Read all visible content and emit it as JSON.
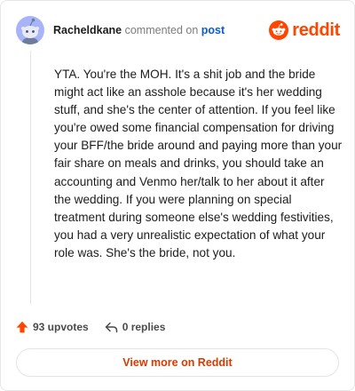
{
  "comment": {
    "username": "Racheldkane",
    "action_text": " commented on ",
    "post_link_text": "post",
    "body": "YTA. You're the MOH. It's a shit job and the bride might act like an asshole because it's her wedding stuff, and she's the center of attention. If you feel like you're owed some financial compensation for driving your BFF/the bride around and paying more than your fair share on meals and drinks, you should take an accounting and Venmo her/talk to her about it after the wedding. If you were planning on special treatment during someone else's wedding festivities, you had a very unrealistic expectation of what your role was. She's the bride, not you."
  },
  "brand": {
    "name": "reddit",
    "icon": "reddit-logo-icon",
    "color": "#ff4500"
  },
  "footer": {
    "upvotes_label": "93 upvotes",
    "replies_label": "0 replies",
    "upvote_icon": "upvote-arrow-icon",
    "reply_icon": "reply-arrow-icon",
    "upvote_color": "#ff4500"
  },
  "cta": {
    "label": "View more on Reddit",
    "color": "#d93a00"
  }
}
